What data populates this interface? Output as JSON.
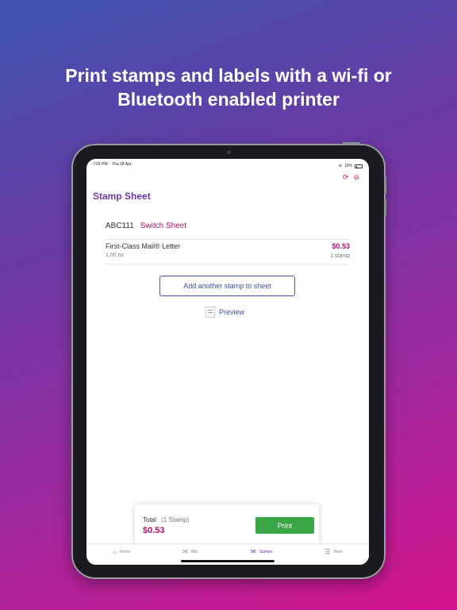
{
  "headline": {
    "line1": "Print stamps and labels with a wi-fi or",
    "line2": "Bluetooth enabled printer"
  },
  "status_bar": {
    "time": "7:02 PM",
    "date": "Thu 28 Apr",
    "battery": "10%"
  },
  "header": {
    "title": "Stamp Sheet",
    "icons": [
      "refresh-icon",
      "minus-circle-icon"
    ]
  },
  "sheet": {
    "name": "ABC111",
    "switch_label": "Switch Sheet"
  },
  "stamp_item": {
    "name": "First-Class Mail® Letter",
    "weight": "1.00 oz",
    "price": "$0.53",
    "quantity": "1 stamp"
  },
  "actions": {
    "add_stamp_label": "Add another stamp to sheet",
    "preview_label": "Preview"
  },
  "total": {
    "label": "Total",
    "count": "(1 Stamp)",
    "amount": "$0.53",
    "print_label": "Print"
  },
  "tabbar": {
    "tabs": [
      {
        "label": "Home",
        "icon": "home-icon",
        "active": false
      },
      {
        "label": "Bills",
        "icon": "bills-icon",
        "active": false
      },
      {
        "label": "Stamps",
        "icon": "envelope-icon",
        "active": true
      },
      {
        "label": "More",
        "icon": "menu-icon",
        "active": false
      }
    ]
  },
  "colors": {
    "accent_purple": "#6a3aa4",
    "accent_magenta": "#b0156e",
    "print_green": "#3aa645",
    "link_blue": "#3d4c9c"
  }
}
